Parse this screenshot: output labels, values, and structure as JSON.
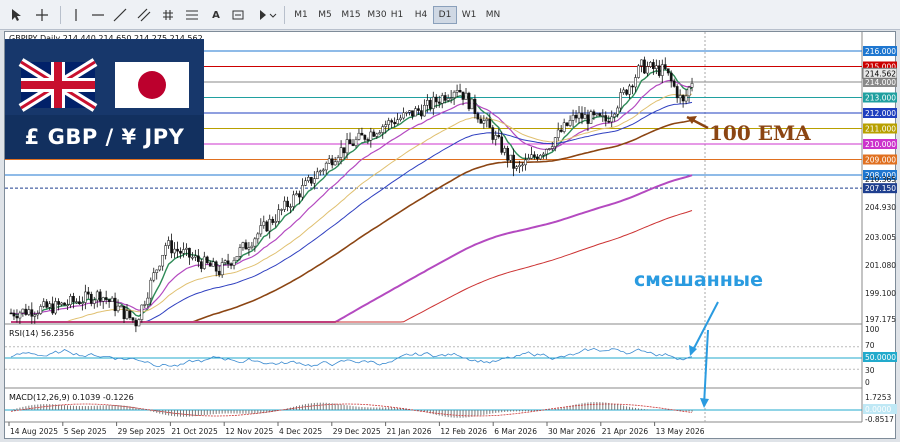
{
  "toolbar": {
    "icons": [
      "cursor-icon",
      "crosshair-icon",
      "horizontal-line-icon",
      "trend-line-icon",
      "hash-icon",
      "text-icon",
      "label-icon",
      "rectangle-icon",
      "shapes-icon"
    ],
    "text_tool": "A",
    "timeframes": [
      "M1",
      "M5",
      "M15",
      "M30",
      "H1",
      "H4",
      "D1",
      "W1",
      "MN"
    ],
    "active_timeframe": "D1"
  },
  "chart": {
    "header": "GBPJPY,Daily  214.440 214.650 214.275 214.562",
    "banner_text": "£ GBP / ¥ JPY",
    "annotation_ema": "100 EMA",
    "annotation_mixed": "смешанные",
    "rsi_label": "RSI(14) 56.2356",
    "macd_label": "MACD(12,26,9) 0.1039 -0.1226",
    "price_levels": [
      {
        "label": "216.000",
        "value": 216.0,
        "color": "#1f77d0"
      },
      {
        "label": "215.000",
        "value": 215.0,
        "color": "#cc0000"
      },
      {
        "label": "214.000",
        "value": 214.0,
        "color": "#8a8a8a"
      },
      {
        "label": "213.000",
        "value": 213.0,
        "color": "#20a0a0"
      },
      {
        "label": "212.000",
        "value": 212.0,
        "color": "#1f3fbf"
      },
      {
        "label": "211.000",
        "value": 211.0,
        "color": "#b8a000"
      },
      {
        "label": "210.000",
        "value": 210.0,
        "color": "#cc33cc"
      },
      {
        "label": "209.000",
        "value": 209.0,
        "color": "#e07020"
      },
      {
        "label": "208.000",
        "value": 208.0,
        "color": "#1f77d0"
      },
      {
        "label": "207.150",
        "value": 207.15,
        "color": "#1f3f8f"
      }
    ],
    "current_price": "214.562",
    "axis_ticks": [
      "210.365",
      "204.930",
      "203.005",
      "201.080",
      "199.100",
      "197.175"
    ],
    "rsi_ticks": [
      "100",
      "70",
      "50.0000",
      "30",
      "0"
    ],
    "rsi_level": "50.0000",
    "macd_ticks": [
      "1.7253",
      "0.0000",
      "-0.8517"
    ],
    "macd_level": "0.0000",
    "dates": [
      "14 Aug 2025",
      "5 Sep 2025",
      "29 Sep 2025",
      "21 Oct 2025",
      "12 Nov 2025",
      "4 Dec 2025",
      "29 Dec 2025",
      "21 Jan 2026",
      "12 Feb 2026",
      "6 Mar 2026",
      "30 Mar 2026",
      "21 Apr 2026",
      "13 May 2026"
    ],
    "colors": {
      "ema_100": "#8b4513",
      "ema_200": "#cc3333",
      "ema_fast": "#2e8b57",
      "ema_mid": "#b44ac0",
      "ema_slow": "#e0c070",
      "ema_blue": "#3040c0"
    }
  }
}
